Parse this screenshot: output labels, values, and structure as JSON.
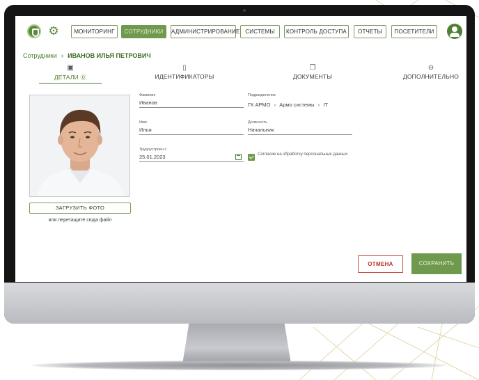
{
  "nav": {
    "items": [
      {
        "label": "МОНИТОРИНГ"
      },
      {
        "label": "СОТРУДНИКИ"
      },
      {
        "label": "АДМИНИСТРИРОВАНИЕ"
      },
      {
        "label": "СИСТЕМЫ"
      },
      {
        "label": "КОНТРОЛЬ ДОСТУПА"
      },
      {
        "label": "ОТЧЕТЫ"
      },
      {
        "label": "ПОСЕТИТЕЛИ"
      }
    ],
    "active_index": 1
  },
  "breadcrumb": {
    "root": "Сотрудники",
    "separator": "›",
    "current": "ИВАНОВ ИЛЬЯ ПЕТРОВИЧ"
  },
  "tabs": [
    {
      "label": "ДЕТАЛИ ⓪",
      "icon": "id-card-icon"
    },
    {
      "label": "ИДЕНТИФИКАТОРЫ",
      "icon": "key-icon"
    },
    {
      "label": "ДОКУМЕНТЫ",
      "icon": "documents-icon"
    },
    {
      "label": "ДОПОЛНИТЕЛЬНО",
      "icon": "more-icon"
    }
  ],
  "photo": {
    "upload_label": "ЗАГРУЗИТЬ ФОТО",
    "drop_hint": "или перетащите сюда файл"
  },
  "form": {
    "last_name": {
      "label": "Фамилия",
      "value": "Иванов"
    },
    "first_name": {
      "label": "Имя",
      "value": "Илья"
    },
    "hired": {
      "label": "Трудоустроен с",
      "value": "25.01.2023"
    },
    "department": {
      "label": "Подразделение",
      "path": [
        "ГК АРМО",
        "Армо системы",
        "IT"
      ]
    },
    "position": {
      "label": "Должность",
      "value": "Начальник"
    },
    "consent": {
      "label": "Согласие на обработку персональных данных",
      "checked": true
    }
  },
  "actions": {
    "cancel": "ОТМЕНА",
    "save": "СОХРАНИТЬ"
  },
  "colors": {
    "accent": "#6f9a4d",
    "accent_dark": "#4e7d32",
    "danger": "#c94a43"
  }
}
